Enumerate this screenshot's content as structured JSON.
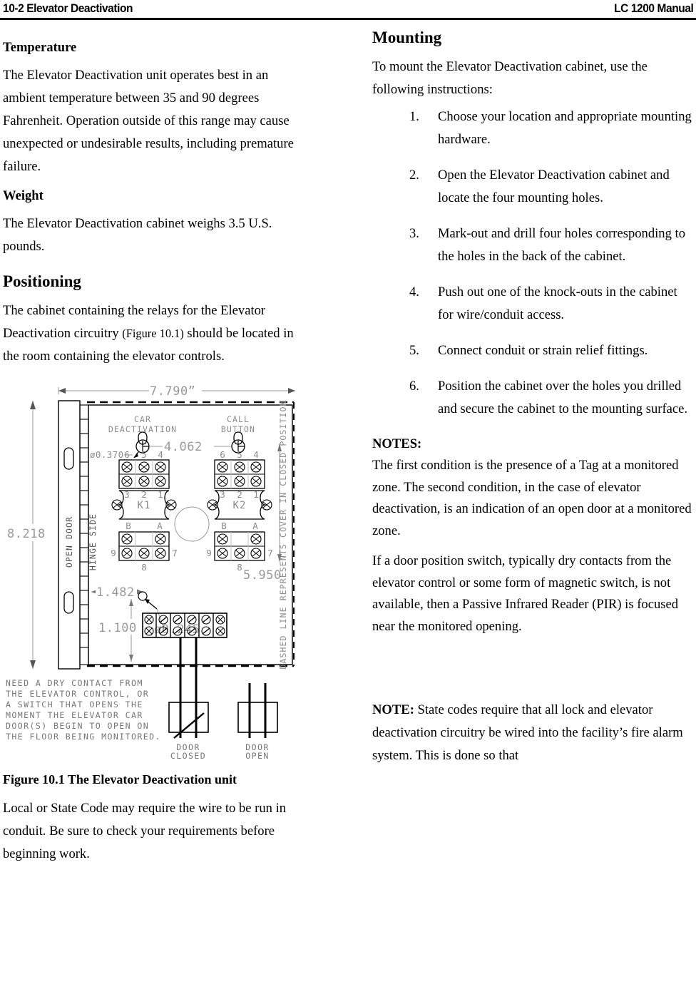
{
  "header": {
    "left": "10-2 Elevator Deactivation",
    "right": "LC 1200 Manual"
  },
  "left_column": {
    "temperature_heading": "Temperature",
    "temperature_body": "The Elevator Deactivation unit operates best in an ambient temperature between 35 and 90 degrees Fahrenheit. Operation outside of this range may cause unexpected or undesirable results, including premature failure.",
    "weight_heading": "Weight",
    "weight_body": "The Elevator Deactivation cabinet weighs 3.5 U.S. pounds.",
    "positioning_heading": "Positioning",
    "positioning_body_1": "The cabinet containing the relays for the Elevator Deactivation circuitry ",
    "positioning_figure_ref": "(Figure 10.1)",
    "positioning_body_2": " should be located in the room containing the elevator controls.",
    "figure_caption": "Figure 10.1 The Elevator Deactivation unit",
    "conduit_body": "Local or State Code may require the wire to be run in conduit. Be sure to check your requirements before beginning work."
  },
  "right_column": {
    "mounting_heading": "Mounting",
    "mounting_intro": "To mount the Elevator Deactivation cabinet, use the following instructions:",
    "steps": [
      {
        "num": "1.",
        "text": "Choose your location and appropriate mounting hardware."
      },
      {
        "num": "2.",
        "text": "Open the Elevator Deactivation cabinet and locate the four mounting holes."
      },
      {
        "num": "3.",
        "text": "Mark-out and drill four holes corresponding to the holes in the back of the cabinet."
      },
      {
        "num": "4.",
        "text": "Push out one of the knock-outs in the cabinet for wire/conduit access."
      },
      {
        "num": "5.",
        "text": "Connect conduit or strain relief fittings."
      },
      {
        "num": "6.",
        "text": "Position the cabinet over the holes you drilled and secure the cabinet to the mounting surface."
      }
    ],
    "notes_label": "NOTES:",
    "notes_body_1": "The first condition is the presence of a Tag at a monitored zone. The second condition, in the case of elevator deactivation, is an indication of an open door at a monitored zone.",
    "notes_body_2": "If a door position switch, typically dry contacts from the elevator control or some form of magnetic switch, is not available, then a Passive Infrared Reader (PIR) is focused near the monitored opening.",
    "note_label": "NOTE:",
    "note_body": " State codes require that all lock and elevator deactivation circuitry be wired into the facility’s fire alarm system. This is done so that"
  },
  "figure": {
    "dimensions": {
      "width_overall": "7.790”",
      "height_overall": "8.218",
      "relay_spacing": "4.062",
      "relay_height": "5.950",
      "hole_x": "1.482",
      "hole_y": "1.100",
      "hole_dia_small": "ø0.245",
      "screw_dia": "ø0.370"
    },
    "labels": {
      "car_deactivation_line1": "CAR",
      "car_deactivation_line2": "DEACTIVATION",
      "call_button_line1": "CALL",
      "call_button_line2": "BUTTON",
      "relay_1": "K1",
      "relay_2": "K2",
      "open_door": "OPEN DOOR",
      "hinge_side": "HINGE SIDE",
      "cover_note": "DASHED LINE REPRESENTS COVER IN CLOSED POSITION",
      "door_closed_line1": "DOOR",
      "door_closed_line2": "CLOSED",
      "door_open_line1": "DOOR",
      "door_open_line2": "OPEN"
    },
    "terminal_numbers_top": [
      "6",
      "5",
      "4"
    ],
    "terminal_numbers_mid": [
      "3",
      "2",
      "1"
    ],
    "terminal_letters": [
      "B",
      "A"
    ],
    "terminal_numbers_bottom": [
      "9",
      "8",
      "7"
    ],
    "note_lines": [
      "NEED A DRY CONTACT FROM",
      "THE ELEVATOR CONTROL, OR",
      "A SWITCH THAT OPENS THE",
      "MOMENT THE ELEVATOR CAR",
      "DOOR(S) BEGIN TO OPEN ON",
      "THE FLOOR BEING MONITORED."
    ]
  },
  "colors": {
    "ink": "#000000",
    "page": "#ffffff",
    "dwg_gray": "#9a9a9a"
  }
}
